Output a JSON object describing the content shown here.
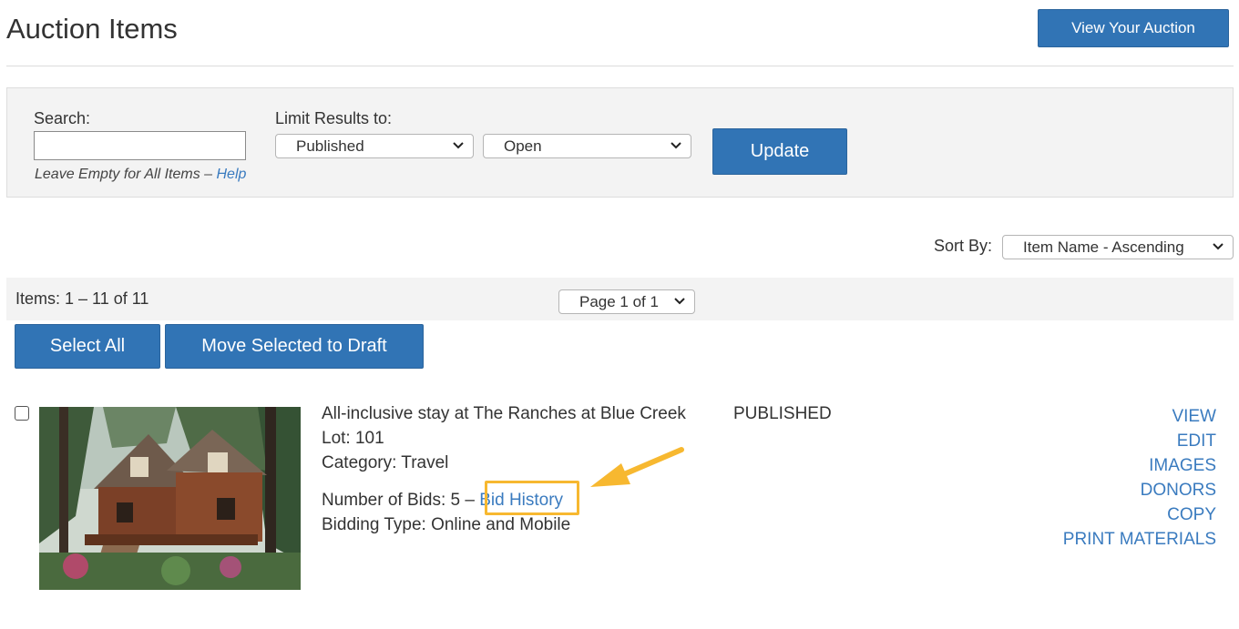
{
  "header": {
    "title": "Auction Items",
    "view_button": "View Your Auction"
  },
  "filters": {
    "search_label": "Search:",
    "search_value": "",
    "hint_text": "Leave Empty for All Items – ",
    "help_link": "Help",
    "limit_label": "Limit Results to:",
    "status_select": "Published",
    "state_select": "Open",
    "update_button": "Update"
  },
  "sort": {
    "label": "Sort By:",
    "selected": "Item Name - Ascending"
  },
  "results": {
    "count_text": "Items: 1 – 11 of 11",
    "page_select": "Page 1 of 1",
    "select_all_button": "Select All",
    "move_draft_button": "Move Selected to Draft"
  },
  "items": [
    {
      "name": "All-inclusive stay at The Ranches at Blue Creek",
      "lot": "Lot: 101",
      "category": "Category: Travel",
      "bids_text": "Number of Bids: 5 – ",
      "bid_history_link": "Bid History",
      "bidding_type": "Bidding Type: Online and Mobile",
      "status": "PUBLISHED",
      "actions": {
        "view": "VIEW",
        "edit": "EDIT",
        "images": "IMAGES",
        "donors": "DONORS",
        "copy": "COPY",
        "print": "PRINT MATERIALS"
      }
    }
  ],
  "colors": {
    "primary_button": "#3174b5",
    "link": "#3a7bbf",
    "highlight": "#f7b830",
    "panel_bg": "#f3f3f3"
  }
}
